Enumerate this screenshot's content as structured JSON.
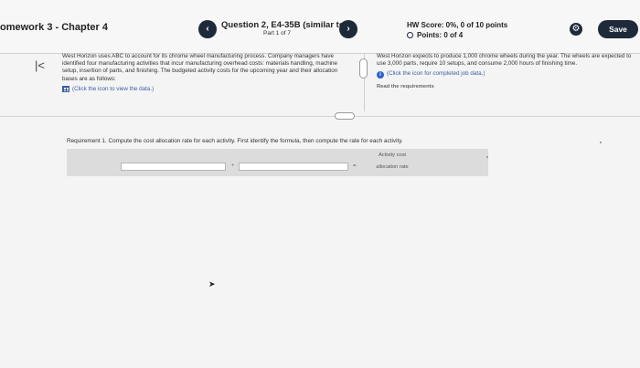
{
  "header": {
    "hw_title": "omework 3 - Chapter 4",
    "prev_icon": "chevron-left-icon",
    "next_icon": "chevron-right-icon",
    "question_title": "Question 2, E4-35B (similar to)",
    "question_part": "Part 1 of 7",
    "hw_score": "HW Score: 0%, 0 of 10 points",
    "points": "Points: 0 of 4",
    "save_label": "Save",
    "settings_icon": "gear-icon"
  },
  "left_panel": {
    "text": "West Horizon uses ABC to account for its chrome wheel manufacturing process. Company managers have identified four manufacturing activities that incur manufacturing overhead costs: materials handling, machine setup, insertion of parts, and finishing. The budgeted activity costs for the upcoming year and their allocation bases are as follows:",
    "data_link": "(Click the icon to view the data.)"
  },
  "right_panel": {
    "text": "West Horizon expects to produce 1,000 chrome wheels during the year. The wheels are expected to use 3,000 parts, require 10 setups, and consume 2,000 hours of finishing time.",
    "job_link": "(Click the icon for completed job data.)",
    "read_requirements": "Read the requirements"
  },
  "requirement": {
    "text": "Requirement 1. Compute the cost allocation rate for each activity. First identify the formula, then compute the rate for each activity.",
    "operator_1": "÷",
    "operator_2": "=",
    "result_label_line1": "Activity cost",
    "result_label_line2": "allocation rate",
    "input_1_value": "",
    "input_2_value": ""
  }
}
